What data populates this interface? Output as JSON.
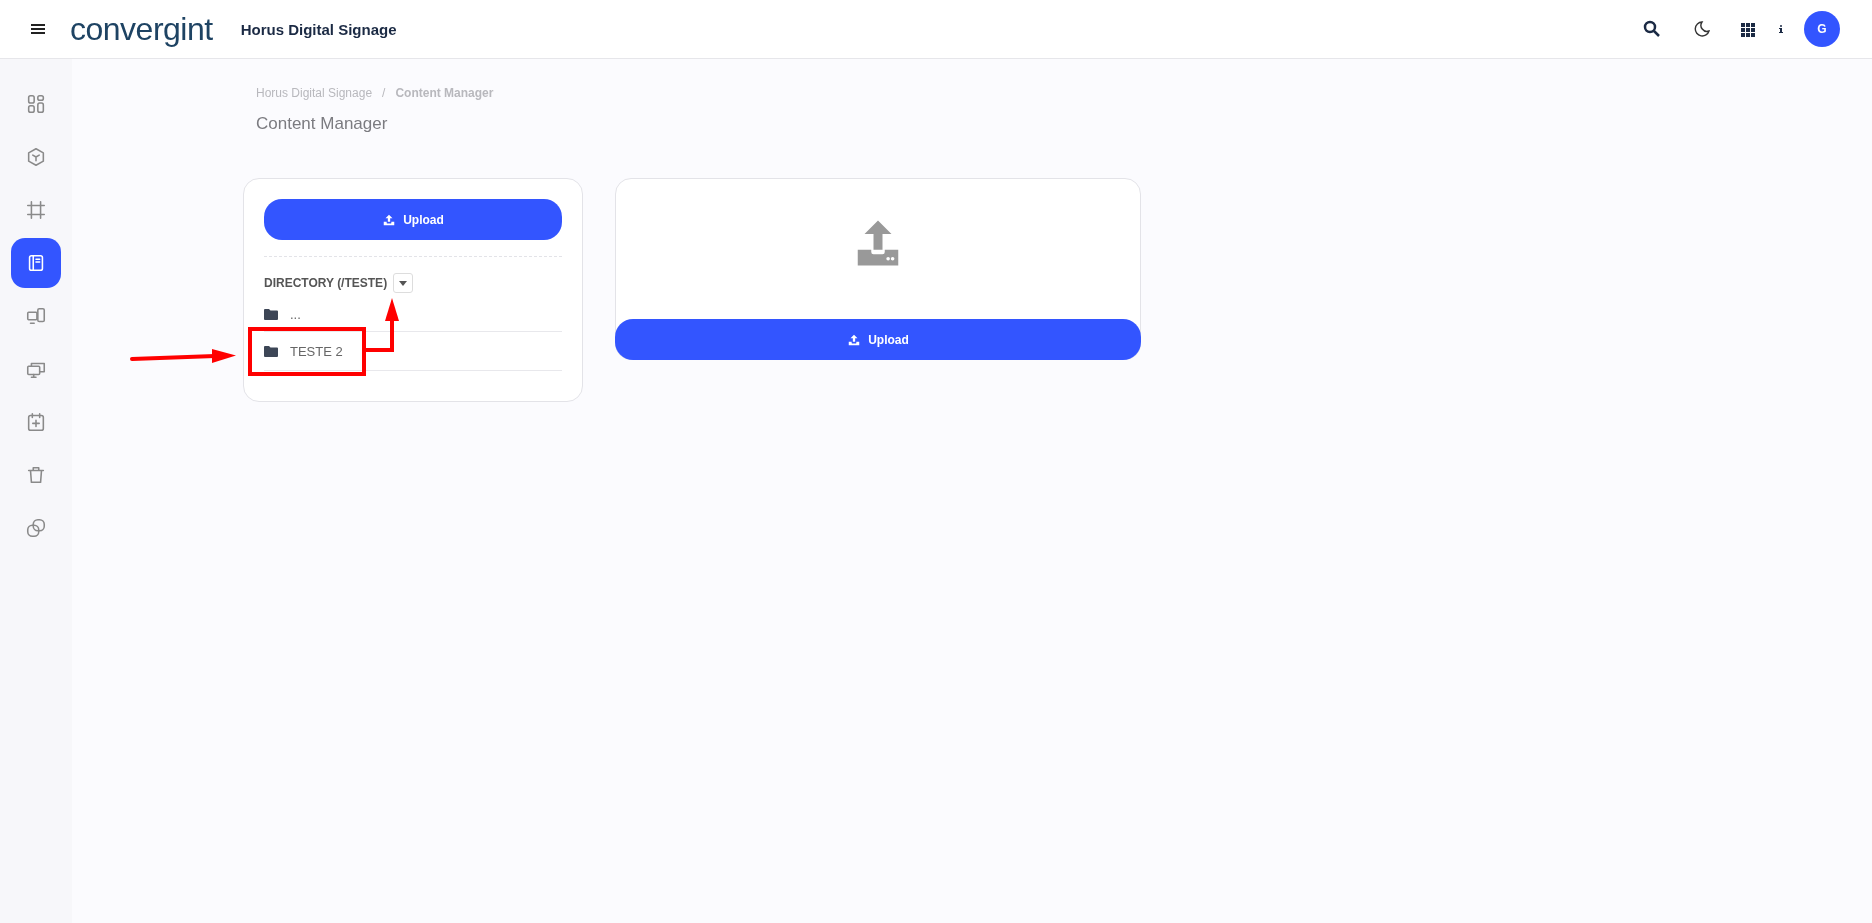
{
  "header": {
    "logo": "convergint",
    "title": "Horus Digital Signage",
    "avatar": "G"
  },
  "sidebar": {
    "items": [
      {
        "selected": false
      },
      {
        "selected": false
      },
      {
        "selected": false
      },
      {
        "selected": true
      },
      {
        "selected": false
      },
      {
        "selected": false
      },
      {
        "selected": false
      },
      {
        "selected": false
      },
      {
        "selected": false
      }
    ]
  },
  "breadcrumb": {
    "separator": "/",
    "items": [
      "Horus Digital Signage",
      "Content Manager"
    ]
  },
  "page_title": "Content Manager",
  "browser": {
    "upload_button": "Upload",
    "directory_label": "DIRECTORY (/TESTE)",
    "folders": [
      "...",
      "TESTE 2"
    ]
  },
  "dropzone": {
    "upload_button": "Upload"
  }
}
